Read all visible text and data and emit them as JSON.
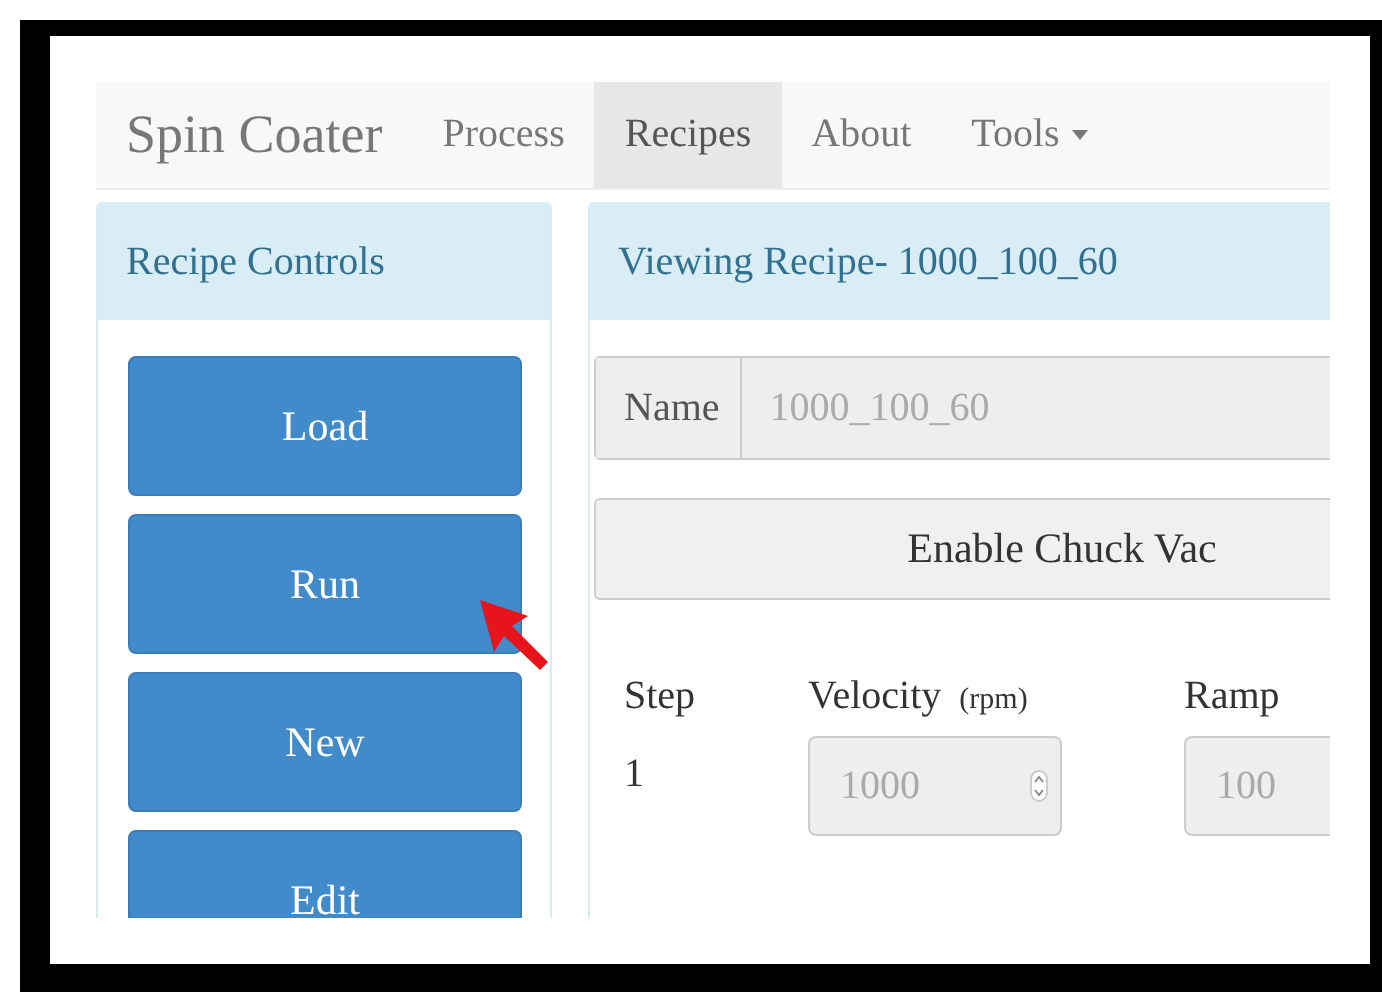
{
  "navbar": {
    "brand": "Spin Coater",
    "items": [
      {
        "label": "Process",
        "selected": false,
        "dropdown": false
      },
      {
        "label": "Recipes",
        "selected": true,
        "dropdown": false
      },
      {
        "label": "About",
        "selected": false,
        "dropdown": false
      },
      {
        "label": "Tools",
        "selected": false,
        "dropdown": true
      }
    ]
  },
  "controls_panel": {
    "title": "Recipe Controls",
    "buttons": [
      "Load",
      "Run",
      "New",
      "Edit"
    ]
  },
  "recipe_panel": {
    "title": "Viewing Recipe- 1000_100_60",
    "name_field": {
      "label": "Name",
      "value": "1000_100_60",
      "disabled": true
    },
    "vac_button": "Enable Chuck Vac",
    "columns": [
      {
        "label": "Step"
      },
      {
        "label": "Velocity",
        "unit": "(rpm)"
      },
      {
        "label": "Ramp"
      }
    ],
    "steps": [
      {
        "step": "1",
        "velocity": "1000",
        "ramp": "100",
        "disabled": true
      }
    ]
  }
}
